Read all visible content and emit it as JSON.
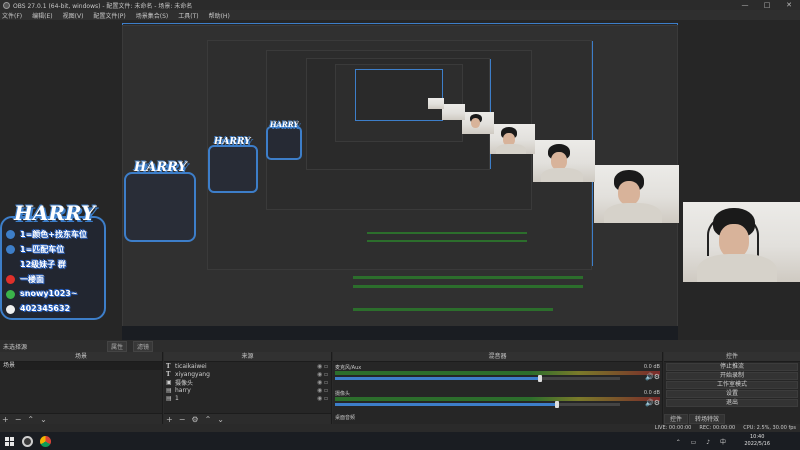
{
  "window": {
    "title": "OBS 27.0.1 (64-bit, windows) - 配置文件: 未命名 - 场景: 未命名",
    "controls": [
      "—",
      "□",
      "✕"
    ]
  },
  "menu": [
    "文件(F)",
    "编辑(E)",
    "视图(V)",
    "配置文件(P)",
    "场景集合(S)",
    "工具(T)",
    "帮助(H)"
  ],
  "overlay": {
    "logo": "HARRY",
    "lines": [
      "1=颜色+找东车位",
      "1=匹配车位",
      "12级妹子 群",
      "一楼面",
      "snowy1023~",
      "402345632"
    ]
  },
  "scenebar": {
    "label": "未选择源",
    "props_button": "属性",
    "filters_button": "滤镜"
  },
  "scenes": {
    "header": "场景",
    "items": [
      {
        "label": "场景",
        "selected": true
      }
    ],
    "footer_icons": [
      "+",
      "−",
      "⌃",
      "⌄"
    ]
  },
  "sources": {
    "header": "来源",
    "items": [
      {
        "label": "ticaikaiwei",
        "icon": "text-icon"
      },
      {
        "label": "xiyangyang",
        "icon": "text-icon"
      },
      {
        "label": "摄像头",
        "icon": "camera-icon"
      },
      {
        "label": "harry",
        "icon": "image-icon"
      },
      {
        "label": "1",
        "icon": "image-icon"
      }
    ],
    "footer_icons": [
      "+",
      "−",
      "⚙",
      "⌃",
      "⌄"
    ]
  },
  "mixer": {
    "header": "混音器",
    "channels": [
      {
        "label": "麦克风/Aux",
        "db": "0.0 dB",
        "level": 0.72
      },
      {
        "label": "摄像头",
        "db": "0.0 dB",
        "level": 0.78
      },
      {
        "label": "桌面音频",
        "db": "",
        "level": 0
      }
    ]
  },
  "controls": {
    "header": "控件",
    "buttons": [
      "停止推流",
      "开始录制",
      "工作室模式",
      "设置",
      "退出"
    ],
    "tabs": [
      "控件",
      "转场特效"
    ]
  },
  "status": {
    "live": "LIVE: 00:00:00",
    "rec": "REC: 00:00:00",
    "cpu": "CPU: 2.5%, 30.00 fps"
  },
  "taskbar": {
    "time": "10:40",
    "date": "2022/5/16"
  }
}
